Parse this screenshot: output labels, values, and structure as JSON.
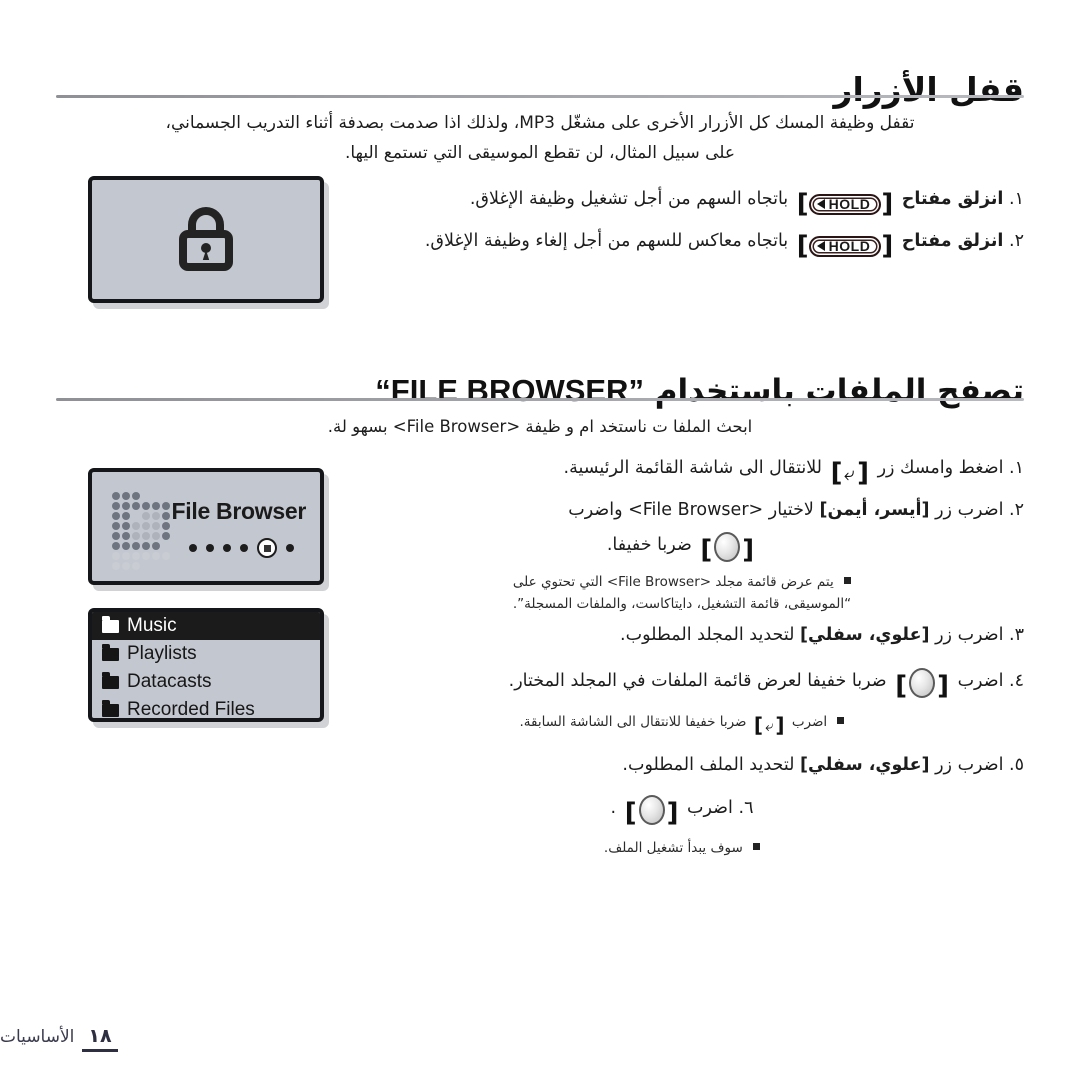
{
  "document": {
    "language": "Arabic",
    "page_number": "١٨",
    "footer_section": "الأساسيات"
  },
  "section_lock": {
    "title": "قفل الأزرار",
    "intro_line1": "تقفل وظيفة المسك كل الأزرار الأخرى على مشغّل MP3، ولذلك اذا صدمت بصدفة أثناء التدريب الجسماني،",
    "intro_line2": "على سبيل المثال، لن تقطع الموسيقى التي تستمع اليها.",
    "key_hold_label": "HOLD",
    "steps": [
      {
        "number": "١.",
        "before_key": "انزلق مفتاح",
        "after_key": "باتجاه السهم من أجل تشغيل وظيفة الإغلاق."
      },
      {
        "number": "٢.",
        "before_key": "انزلق مفتاح",
        "after_key": "باتجاه معاكس للسهم من أجل إلغاء وظيفة الإغلاق."
      }
    ],
    "screen_icon": "lock-icon"
  },
  "section_browser": {
    "title_ar": "تصفح الملفات باستخدام",
    "title_en": "“FILE BROWSER”",
    "intro": "ابحث الملفا ت ناستخد ام و ظيفة <File Browser> بسهو لة.",
    "steps": [
      {
        "number": "١.",
        "part_a": "اضغط وامسك زر",
        "part_b": "للانتقال الى شاشة القائمة الرئيسية."
      },
      {
        "number": "٢.",
        "part_a": "اضرب زر",
        "key_label": "[أيسر، أيمن]",
        "part_b": "لاختيار <File Browser> واضرب",
        "part_c": "ضربا خفيفا."
      },
      {
        "number": "٣.",
        "part_a": "اضرب زر",
        "key_label": "[علوي، سفلي]",
        "part_b": "لتحديد المجلد المطلوب."
      },
      {
        "number": "٤.",
        "part_a": "اضرب",
        "part_b": "ضربا خفيفا لعرض قائمة الملفات في المجلد المختار."
      },
      {
        "number": "٥.",
        "part_a": "اضرب زر",
        "key_label": "[علوي، سفلي]",
        "part_b": "لتحديد الملف المطلوب."
      },
      {
        "number": "٦.",
        "part_a": "اضرب",
        "part_b": "."
      }
    ],
    "notes": [
      {
        "line1": "يتم عرض قائمة مجلد <File Browser> التي تحتوي على",
        "line2": "“الموسيقى، قائمة التشغيل، دايتاكاست، والملفات المسجلة”."
      },
      {
        "line1": "اضرب",
        "line2": "ضربا خفيفا للانتقال الى الشاشة السابقة."
      },
      {
        "line1": "سوف يبدأ تشغيل الملف."
      }
    ],
    "device_screen": {
      "title": "File Browser",
      "dots_count": 6,
      "selected_dot_index": 4
    },
    "folder_list": [
      {
        "label": "Music",
        "selected": true
      },
      {
        "label": "Playlists",
        "selected": false
      },
      {
        "label": "Datacasts",
        "selected": false
      },
      {
        "label": "Recorded Files",
        "selected": false
      }
    ]
  },
  "colors": {
    "screen_bg": "#c3c7cf",
    "screen_border": "#15161a",
    "selected_row_bg": "#1b1b1b",
    "rule": "#9a9aa2",
    "footer_text": "#3b3b4e"
  }
}
